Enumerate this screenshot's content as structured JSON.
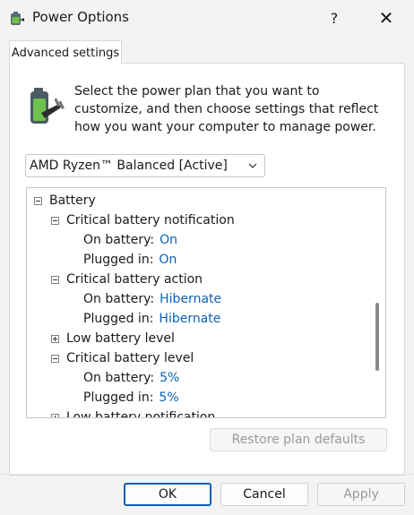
{
  "window": {
    "title": "Power Options",
    "help_icon": "?",
    "close_icon": "✕"
  },
  "tab": {
    "label": "Advanced settings"
  },
  "description": "Select the power plan that you want to customize, and then choose settings that reflect how you want your computer to manage power.",
  "plan_select": {
    "selected": "AMD Ryzen™ Balanced [Active]"
  },
  "tree": {
    "battery": "Battery",
    "crit_notif": "Critical battery notification",
    "crit_notif_on_label": "On battery:",
    "crit_notif_on_val": "On",
    "crit_notif_plug_label": "Plugged in:",
    "crit_notif_plug_val": "On",
    "crit_action": "Critical battery action",
    "crit_action_on_label": "On battery:",
    "crit_action_on_val": "Hibernate",
    "crit_action_plug_label": "Plugged in:",
    "crit_action_plug_val": "Hibernate",
    "low_level": "Low battery level",
    "crit_level": "Critical battery level",
    "crit_level_on_label": "On battery:",
    "crit_level_on_val": "5%",
    "crit_level_plug_label": "Plugged in:",
    "crit_level_plug_val": "5%",
    "low_notif": "Low battery notification"
  },
  "buttons": {
    "restore": "Restore plan defaults",
    "ok": "OK",
    "cancel": "Cancel",
    "apply": "Apply"
  },
  "colors": {
    "accent": "#0a5fb4",
    "value_link": "#0b63b8"
  }
}
